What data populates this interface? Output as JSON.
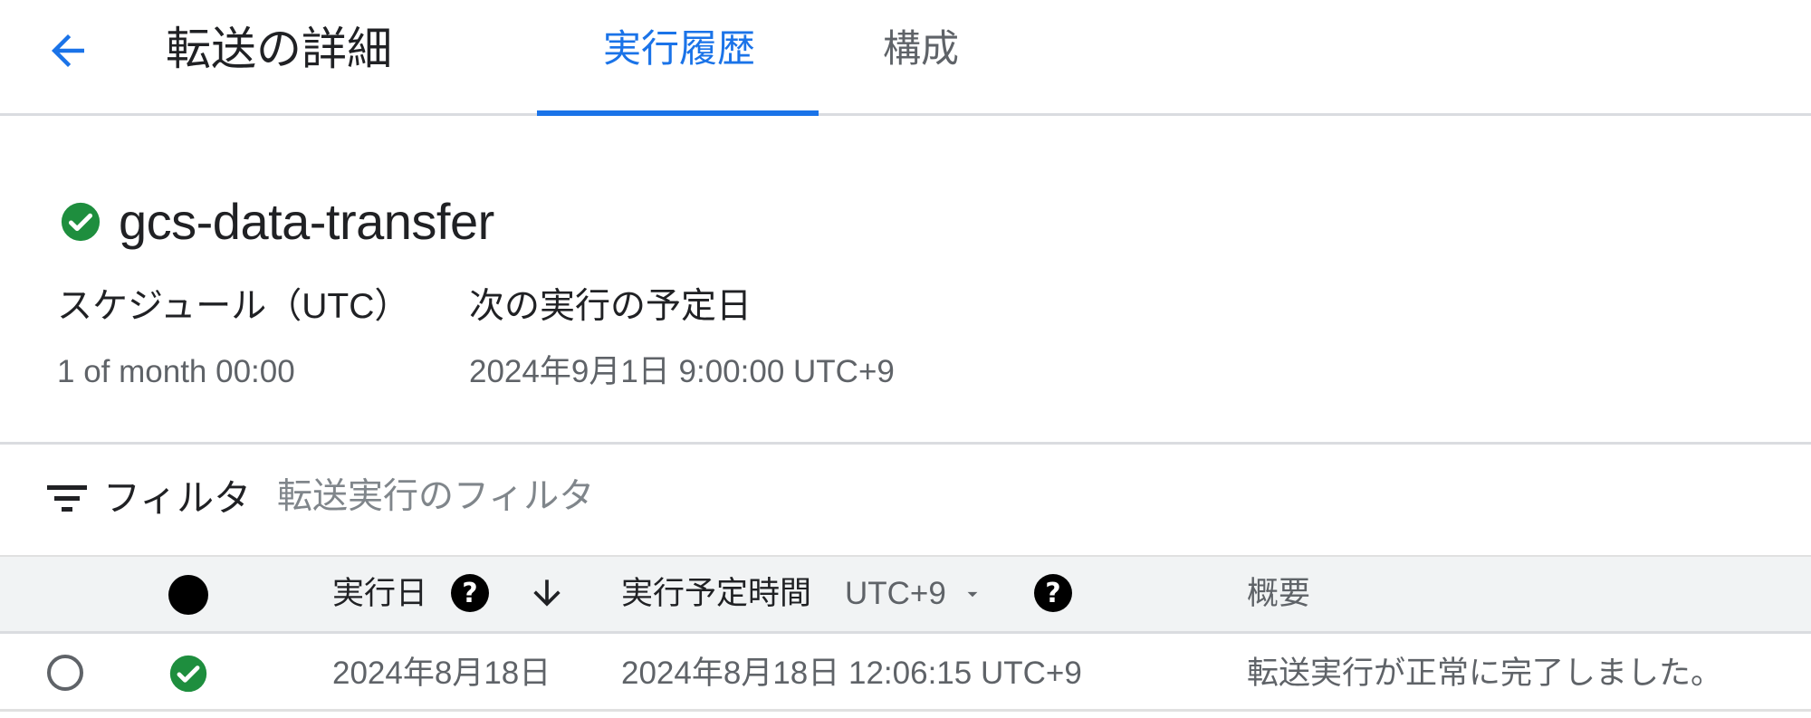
{
  "header": {
    "back_icon": "arrow-back-icon",
    "title": "転送の詳細",
    "tabs": [
      {
        "label": "実行履歴",
        "active": true
      },
      {
        "label": "構成",
        "active": false
      }
    ]
  },
  "transfer": {
    "status_icon": "check-circle-icon",
    "name": "gcs-data-transfer",
    "schedule_label": "スケジュール（UTC）",
    "schedule_value": "1 of month 00:00",
    "next_run_label": "次の実行の予定日",
    "next_run_value": "2024年9月1日 9:00:00 UTC+9"
  },
  "filter": {
    "icon": "filter-list-icon",
    "label": "フィルタ",
    "placeholder": "転送実行のフィルタ",
    "value": ""
  },
  "table": {
    "columns": {
      "status_icon": "status-dot-icon",
      "run_date": "実行日",
      "scheduled_time": "実行予定時間",
      "timezone": "UTC+9",
      "summary": "概要"
    },
    "rows": [
      {
        "selected": false,
        "status": "success",
        "run_date": "2024年8月18日",
        "scheduled_time": "2024年8月18日 12:06:15 UTC+9",
        "summary": "転送実行が正常に完了しました。"
      }
    ]
  },
  "colors": {
    "accent": "#1a73e8",
    "success": "#1e8e3e",
    "text": "#202124",
    "muted": "#5f6368"
  }
}
